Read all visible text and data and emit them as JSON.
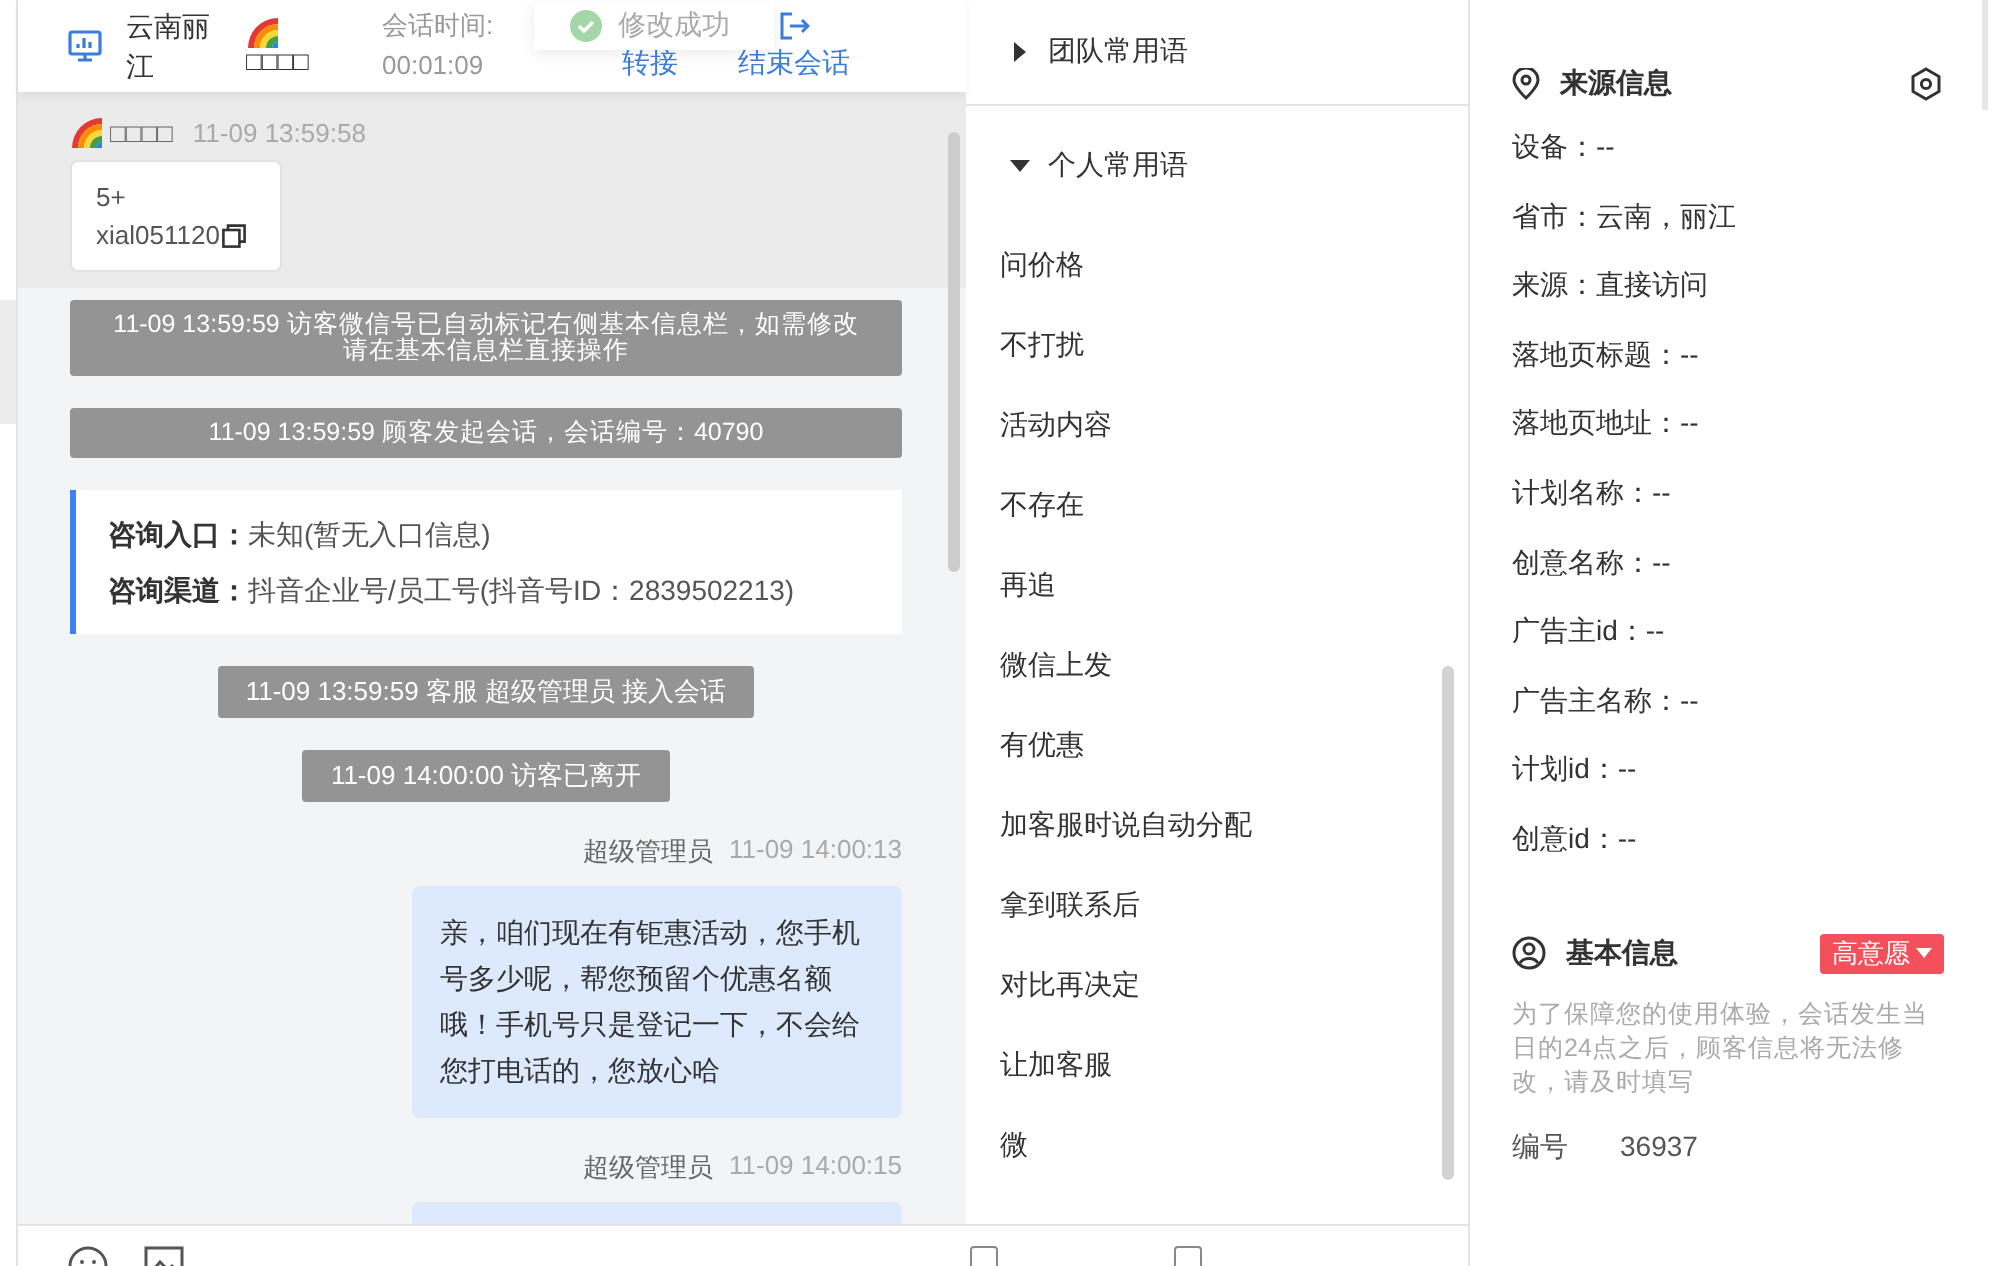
{
  "header": {
    "location": "云南丽江",
    "visitor_name": "□□□□",
    "session_time_label": "会话时间:",
    "session_time": "00:01:09",
    "actions": [
      {
        "label": "转接",
        "kind": "transfer"
      },
      {
        "label": "结束会话",
        "kind": "end"
      }
    ]
  },
  "toast": {
    "text": "修改成功"
  },
  "messages": [
    {
      "kind": "visitor",
      "name": "□□□□",
      "time": "11-09 13:59:58",
      "lines": [
        "5+",
        "xial051120"
      ]
    },
    {
      "kind": "system",
      "text": "11-09 13:59:59 访客微信号已自动标记右侧基本信息栏，如需修改请在基本信息栏直接操作"
    },
    {
      "kind": "system",
      "text": "11-09 13:59:59 顾客发起会话，会话编号：40790"
    },
    {
      "kind": "info",
      "rows": [
        {
          "label": "咨询入口：",
          "value": "未知(暂无入口信息)"
        },
        {
          "label": "咨询渠道：",
          "value": "抖音企业号/员工号(抖音号ID：2839502213)"
        }
      ]
    },
    {
      "kind": "system",
      "text": "11-09 13:59:59 客服 超级管理员 接入会话"
    },
    {
      "kind": "system",
      "text": "11-09 14:00:00 访客已离开"
    },
    {
      "kind": "agent",
      "name": "超级管理员",
      "time": "11-09 14:00:13",
      "text": "亲，咱们现在有钜惠活动，您手机号多少呢，帮您预留个优惠名额哦！手机号只是登记一下，不会给您打电话的，您放心哈"
    },
    {
      "kind": "agent",
      "name": "超级管理员",
      "time": "11-09 14:00:15"
    }
  ],
  "phrases": [
    {
      "title": "团队常用语",
      "expanded": false
    },
    {
      "title": "个人常用语",
      "expanded": true,
      "items": [
        "问价格",
        "不打扰",
        "活动内容",
        "不存在",
        "再追",
        "微信上发",
        "有优惠",
        "加客服时说自动分配",
        "拿到联系后",
        "对比再决定",
        "让加客服",
        "微"
      ]
    }
  ],
  "phrase_options": [
    {
      "checked": false
    },
    {
      "checked": false
    }
  ],
  "source_info": {
    "title": "来源信息",
    "lines": [
      "设备：--",
      "省市：云南，丽江",
      "来源：直接访问",
      "落地页标题：--",
      "落地页地址：--",
      "计划名称：--",
      "创意名称：--",
      "广告主id：--",
      "广告主名称：--",
      "计划id：--",
      "创意id：--"
    ]
  },
  "basic_info": {
    "title": "基本信息",
    "intent_tag": "高意愿",
    "notice": "为了保障您的使用体验，会话发生当日的24点之后，顾客信息将无法修改，请及时填写",
    "fields": [
      {
        "label": "编号",
        "value": "36937"
      }
    ]
  }
}
